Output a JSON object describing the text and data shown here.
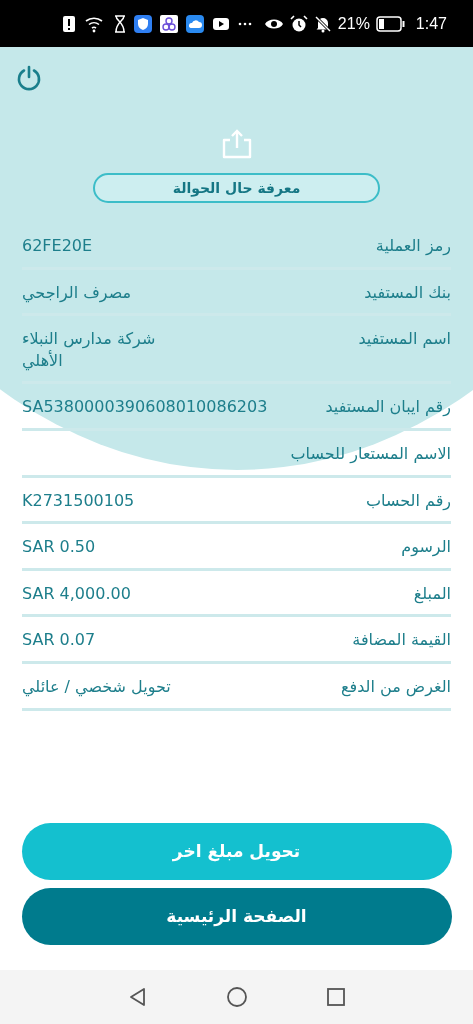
{
  "status_bar": {
    "battery": "21%",
    "time": "1:47"
  },
  "header": {
    "title": "معرفة حال الحوالة"
  },
  "details": [
    {
      "label": "رمز العملية",
      "value": "62FE20E"
    },
    {
      "label": "بنك المستفيد",
      "value": "مصرف الراجحي"
    },
    {
      "label": "اسم المستفيد",
      "value": "شركة مدارس النبلاء الأهلي"
    },
    {
      "label": "رقم ايبان المستفيد",
      "value": "SA5380000390608010086203"
    },
    {
      "label": "الاسم المستعار للحساب"
    },
    {
      "label": "رقم الحساب",
      "value": "K2731500105"
    },
    {
      "label": "الرسوم",
      "value": "SAR 0.50"
    },
    {
      "label": "المبلغ",
      "value": "SAR 4,000.00"
    },
    {
      "label": "القيمة المضافة",
      "value": "SAR 0.07"
    },
    {
      "label": "الغرض من الدفع",
      "value": "تحويل شخصي / عائلي"
    }
  ],
  "buttons": [
    {
      "label": "تحويل مبلغ اخر",
      "kind": "secondary"
    },
    {
      "label": "الصفحة الرئيسية",
      "kind": "primary"
    }
  ]
}
